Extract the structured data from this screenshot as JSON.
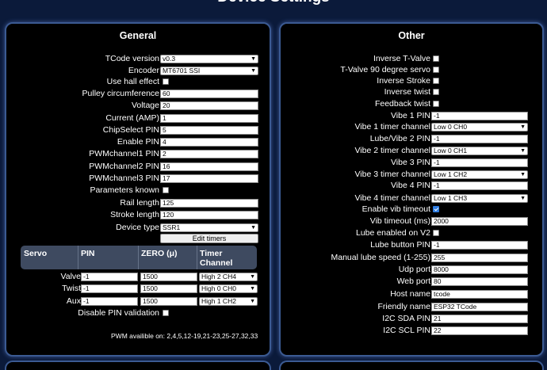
{
  "page": {
    "title": "Device Settings"
  },
  "general": {
    "title": "General",
    "tcode_version": {
      "label": "TCode version",
      "value": "v0.3"
    },
    "encoder": {
      "label": "Encoder",
      "value": "MT6701 SSI"
    },
    "use_hall_effect": {
      "label": "Use hall effect",
      "checked": false
    },
    "pulley_circumference": {
      "label": "Pulley circumference",
      "value": "60"
    },
    "voltage": {
      "label": "Voltage",
      "value": "20"
    },
    "current": {
      "label": "Current (AMP)",
      "value": "1"
    },
    "chipselect_pin": {
      "label": "ChipSelect PIN",
      "value": "5"
    },
    "enable_pin": {
      "label": "Enable PIN",
      "value": "4"
    },
    "pwm1": {
      "label": "PWMchannel1 PIN",
      "value": "2"
    },
    "pwm2": {
      "label": "PWMchannel2 PIN",
      "value": "16"
    },
    "pwm3": {
      "label": "PWMchannel3 PIN",
      "value": "17"
    },
    "parameters_known": {
      "label": "Parameters known",
      "checked": false
    },
    "rail_length": {
      "label": "Rail length",
      "value": "125"
    },
    "stroke_length": {
      "label": "Stroke length",
      "value": "120"
    },
    "device_type": {
      "label": "Device type",
      "value": "SSR1"
    },
    "edit_timers": "Edit timers",
    "servo_table": {
      "headers": [
        "Servo",
        "PIN",
        "ZERO (μ)",
        "Timer Channel"
      ],
      "rows": [
        {
          "name": "Valve",
          "pin": "-1",
          "zero": "1500",
          "timer": "High 2 CH4"
        },
        {
          "name": "Twist",
          "pin": "-1",
          "zero": "1500",
          "timer": "High 0 CH0"
        },
        {
          "name": "Aux",
          "pin": "-1",
          "zero": "1500",
          "timer": "High 1 CH2"
        }
      ]
    },
    "disable_pin_validation": {
      "label": "Disable PIN validation",
      "checked": false
    },
    "pwm_note": "PWM availible on: 2,4,5,12-19,21-23,25-27,32,33"
  },
  "other": {
    "title": "Other",
    "inverse_tvalve": {
      "label": "Inverse T-Valve",
      "checked": false
    },
    "tvalve_90": {
      "label": "T-Valve 90 degree servo",
      "checked": false
    },
    "inverse_stroke": {
      "label": "Inverse Stroke",
      "checked": false
    },
    "inverse_twist": {
      "label": "Inverse twist",
      "checked": false
    },
    "feedback_twist": {
      "label": "Feedback twist",
      "checked": false
    },
    "vibe1_pin": {
      "label": "Vibe 1 PIN",
      "value": "-1"
    },
    "vibe1_timer": {
      "label": "Vibe 1 timer channel",
      "value": "Low 0 CH0"
    },
    "lube_vibe2_pin": {
      "label": "Lube/Vibe 2 PIN",
      "value": "-1"
    },
    "vibe2_timer": {
      "label": "Vibe 2 timer channel",
      "value": "Low 0 CH1"
    },
    "vibe3_pin": {
      "label": "Vibe 3 PIN",
      "value": "-1"
    },
    "vibe3_timer": {
      "label": "Vibe 3 timer channel",
      "value": "Low 1 CH2"
    },
    "vibe4_pin": {
      "label": "Vibe 4 PIN",
      "value": "-1"
    },
    "vibe4_timer": {
      "label": "Vibe 4 timer channel",
      "value": "Low 1 CH3"
    },
    "enable_vib_timeout": {
      "label": "Enable vib timeout",
      "checked": true
    },
    "vib_timeout": {
      "label": "Vib timeout (ms)",
      "value": "2000"
    },
    "lube_on_v2": {
      "label": "Lube enabled on V2",
      "checked": false
    },
    "lube_button_pin": {
      "label": "Lube button PIN",
      "value": "-1"
    },
    "manual_lube_speed": {
      "label": "Manual lube speed (1-255)",
      "value": "255"
    },
    "udp_port": {
      "label": "Udp port",
      "value": "8000"
    },
    "web_port": {
      "label": "Web port",
      "value": "80"
    },
    "host_name": {
      "label": "Host name",
      "value": "tcode"
    },
    "friendly_name": {
      "label": "Friendly name",
      "value": "ESP32 TCode"
    },
    "i2c_sda": {
      "label": "I2C SDA PIN",
      "value": "21"
    },
    "i2c_scl": {
      "label": "I2C SCL PIN",
      "value": "22"
    }
  },
  "colors": {
    "background": "#0b1a3a",
    "panel": "#000000",
    "panel_border": "#3b5a92",
    "checkbox_checked": "#2f7de1",
    "table_header": "#3e4a60"
  }
}
